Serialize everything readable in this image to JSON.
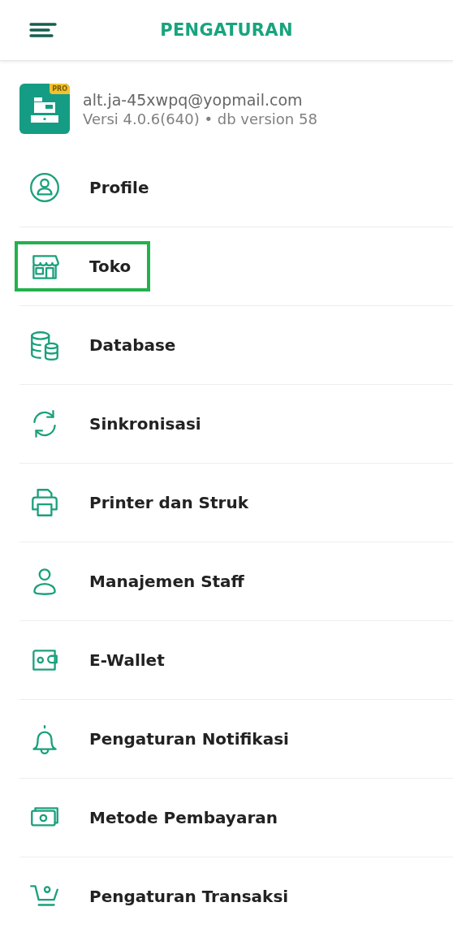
{
  "header": {
    "title": "PENGATURAN"
  },
  "account": {
    "badge": "PRO",
    "email": "alt.ja-45xwpq@yopmail.com",
    "version": "Versi 4.0.6(640) • db version 58"
  },
  "items": [
    {
      "kind": "profile",
      "label": "Profile",
      "highlighted": false
    },
    {
      "kind": "store",
      "label": "Toko",
      "highlighted": true
    },
    {
      "kind": "database",
      "label": "Database",
      "highlighted": false
    },
    {
      "kind": "sync",
      "label": "Sinkronisasi",
      "highlighted": false
    },
    {
      "kind": "printer",
      "label": "Printer dan Struk",
      "highlighted": false
    },
    {
      "kind": "staff",
      "label": "Manajemen Staff",
      "highlighted": false
    },
    {
      "kind": "wallet",
      "label": "E-Wallet",
      "highlighted": false
    },
    {
      "kind": "bell",
      "label": "Pengaturan Notifikasi",
      "highlighted": false
    },
    {
      "kind": "cash",
      "label": "Metode Pembayaran",
      "highlighted": false
    },
    {
      "kind": "cart",
      "label": "Pengaturan Transaksi",
      "highlighted": false
    }
  ]
}
